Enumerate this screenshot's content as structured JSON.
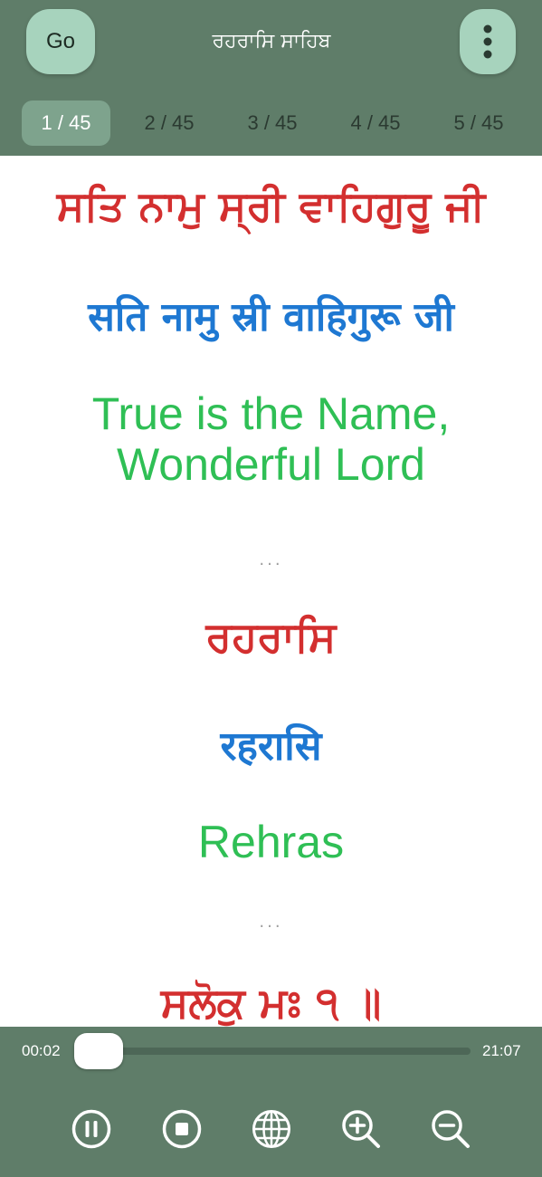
{
  "header": {
    "go_label": "Go",
    "title": "ਰਹਰਾਸਿ ਸਾਹਿਬ",
    "menu_icon": "more-vertical-icon",
    "tabs": [
      {
        "label": "1 / 45",
        "active": true
      },
      {
        "label": "2 / 45",
        "active": false
      },
      {
        "label": "3 / 45",
        "active": false
      },
      {
        "label": "4 / 45",
        "active": false
      },
      {
        "label": "5 / 45",
        "active": false
      }
    ]
  },
  "content": {
    "verses": [
      {
        "gurmukhi": "ਸਤਿ ਨਾਮੁ ਸ੍ਰੀ ਵਾਹਿਗੁਰੂ ਜੀ",
        "hindi": "सति नामु स्री वाहिगुरू जी",
        "english_line1": "True is the Name,",
        "english_line2": "Wonderful Lord",
        "separator": "..."
      },
      {
        "gurmukhi": "ਰਹਰਾਸਿ",
        "hindi": "रहरासि",
        "english": "Rehras",
        "separator": "..."
      },
      {
        "gurmukhi": "ਸਲੋਕੁ ਮਃ ੧ ॥"
      }
    ]
  },
  "player": {
    "elapsed": "00:02",
    "duration": "21:07",
    "progress_fraction": 0.002,
    "controls": [
      "pause-icon",
      "stop-icon",
      "globe-icon",
      "zoom-in-icon",
      "zoom-out-icon"
    ]
  },
  "colors": {
    "bar": "#5f7d69",
    "button_bg": "#a7d3bd",
    "tab_active": "#7ea38d",
    "gurmukhi": "#d32f2f",
    "hindi": "#1e78d2",
    "english": "#2fbf55"
  }
}
